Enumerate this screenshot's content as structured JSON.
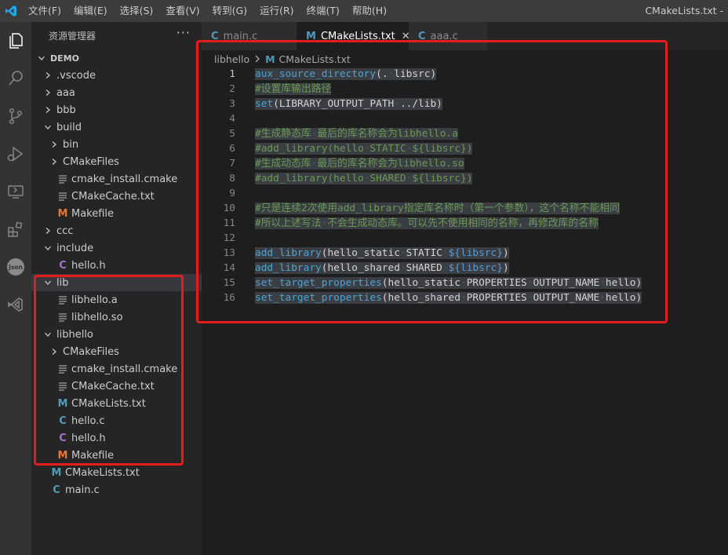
{
  "window": {
    "title": "CMakeLists.txt -",
    "menu": [
      "文件(F)",
      "编辑(E)",
      "选择(S)",
      "查看(V)",
      "转到(G)",
      "运行(R)",
      "终端(T)",
      "帮助(H)"
    ]
  },
  "sidebar": {
    "header": "资源管理器",
    "more": "···",
    "tree": [
      {
        "label": "DEMO",
        "kind": "root",
        "chev": "down",
        "indent": 0
      },
      {
        "label": ".vscode",
        "kind": "folder",
        "chev": "right",
        "indent": 1
      },
      {
        "label": "aaa",
        "kind": "folder",
        "chev": "right",
        "indent": 1
      },
      {
        "label": "bbb",
        "kind": "folder",
        "chev": "right",
        "indent": 1
      },
      {
        "label": "build",
        "kind": "folder",
        "chev": "down",
        "indent": 1
      },
      {
        "label": "bin",
        "kind": "folder",
        "chev": "right",
        "indent": 2
      },
      {
        "label": "CMakeFiles",
        "kind": "folder",
        "chev": "right",
        "indent": 2
      },
      {
        "label": "cmake_install.cmake",
        "kind": "txt",
        "indent": 2
      },
      {
        "label": "CMakeCache.txt",
        "kind": "txt",
        "indent": 2
      },
      {
        "label": "Makefile",
        "kind": "make",
        "indent": 2
      },
      {
        "label": "ccc",
        "kind": "folder",
        "chev": "right",
        "indent": 1
      },
      {
        "label": "include",
        "kind": "folder",
        "chev": "down",
        "indent": 1
      },
      {
        "label": "hello.h",
        "kind": "h",
        "indent": 2
      },
      {
        "label": "lib",
        "kind": "folder",
        "chev": "down",
        "indent": 1,
        "active": true
      },
      {
        "label": "libhello.a",
        "kind": "txt",
        "indent": 2
      },
      {
        "label": "libhello.so",
        "kind": "txt",
        "indent": 2
      },
      {
        "label": "libhello",
        "kind": "folder",
        "chev": "down",
        "indent": 1
      },
      {
        "label": "CMakeFiles",
        "kind": "folder",
        "chev": "right",
        "indent": 2
      },
      {
        "label": "cmake_install.cmake",
        "kind": "txt",
        "indent": 2
      },
      {
        "label": "CMakeCache.txt",
        "kind": "txt",
        "indent": 2
      },
      {
        "label": "CMakeLists.txt",
        "kind": "cmake",
        "indent": 2
      },
      {
        "label": "hello.c",
        "kind": "c",
        "indent": 2
      },
      {
        "label": "hello.h",
        "kind": "h",
        "indent": 2
      },
      {
        "label": "Makefile",
        "kind": "make",
        "indent": 2
      },
      {
        "label": "CMakeLists.txt",
        "kind": "cmake",
        "indent": 1
      },
      {
        "label": "main.c",
        "kind": "c",
        "indent": 1
      }
    ]
  },
  "tabs": [
    {
      "label": "main.c",
      "icon": "C",
      "kind": "c",
      "active": false
    },
    {
      "label": "CMakeLists.txt",
      "icon": "M",
      "kind": "cmake",
      "active": true,
      "close": "✕"
    },
    {
      "label": "aaa.c",
      "icon": "C",
      "kind": "c",
      "active": false
    }
  ],
  "breadcrumb": {
    "folder": "libhello",
    "file": "CMakeLists.txt",
    "icon": "M"
  },
  "editor": {
    "current_line": 1,
    "lines": [
      [
        [
          "fn",
          "aux_source_directory"
        ],
        [
          "tx",
          "("
        ],
        [
          "tx",
          "."
        ],
        [
          "ws",
          "·"
        ],
        [
          "tx",
          "libsrc)"
        ]
      ],
      [
        [
          "cm",
          "#设置库输出路径"
        ]
      ],
      [
        [
          "fn",
          "set"
        ],
        [
          "tx",
          "(LIBRARY_OUTPUT_PATH"
        ],
        [
          "ws",
          "·"
        ],
        [
          "tx",
          "../lib)"
        ]
      ],
      [],
      [
        [
          "cm",
          "#生成静态库"
        ],
        [
          "ws",
          "·"
        ],
        [
          "cm",
          "最后的库名称会为libhello.a"
        ]
      ],
      [
        [
          "cm",
          "#add_library(hello"
        ],
        [
          "ws",
          "·"
        ],
        [
          "cm",
          "STATIC"
        ],
        [
          "ws",
          "·"
        ],
        [
          "cm",
          "${libsrc})"
        ]
      ],
      [
        [
          "cm",
          "#生成动态库"
        ],
        [
          "ws",
          "·"
        ],
        [
          "cm",
          "最后的库名称会为libhello.so"
        ]
      ],
      [
        [
          "cm",
          "#add_library(hello"
        ],
        [
          "ws",
          "·"
        ],
        [
          "cm",
          "SHARED"
        ],
        [
          "ws",
          "·"
        ],
        [
          "cm",
          "${libsrc})"
        ]
      ],
      [],
      [
        [
          "cm",
          "#只是连续2次使用add_library指定库名称时（第一个参数），这个名称不能相同"
        ]
      ],
      [
        [
          "cm",
          "#所以上述写法"
        ],
        [
          "ws",
          "·"
        ],
        [
          "cm",
          "不会生成动态库。可以先不使用相同的名称，再修改库的名称"
        ]
      ],
      [],
      [
        [
          "fn",
          "add_library"
        ],
        [
          "tx",
          "(hello_static"
        ],
        [
          "ws",
          "·"
        ],
        [
          "tx",
          "STATIC"
        ],
        [
          "ws",
          "·"
        ],
        [
          "var",
          "${libsrc}"
        ],
        [
          "tx",
          ")"
        ]
      ],
      [
        [
          "fn",
          "add_library"
        ],
        [
          "tx",
          "(hello_shared"
        ],
        [
          "ws",
          "·"
        ],
        [
          "tx",
          "SHARED"
        ],
        [
          "ws",
          "·"
        ],
        [
          "var",
          "${libsrc}"
        ],
        [
          "tx",
          ")"
        ]
      ],
      [
        [
          "fn",
          "set_target_properties"
        ],
        [
          "tx",
          "(hello_static"
        ],
        [
          "ws",
          "·"
        ],
        [
          "tx",
          "PROPERTIES"
        ],
        [
          "ws",
          "·"
        ],
        [
          "tx",
          "OUTPUT_NAME"
        ],
        [
          "ws",
          "·"
        ],
        [
          "tx",
          "hello)"
        ]
      ],
      [
        [
          "fn",
          "set_target_properties"
        ],
        [
          "tx",
          "(hello_shared"
        ],
        [
          "ws",
          "·"
        ],
        [
          "tx",
          "PROPERTIES"
        ],
        [
          "ws",
          "·"
        ],
        [
          "tx",
          "OUTPUT_NAME"
        ],
        [
          "ws",
          "·"
        ],
        [
          "tx",
          "hello)"
        ]
      ]
    ]
  },
  "colors": {
    "accent": "#007acc",
    "annotation": "#e31c1c",
    "comment": "#6a9955",
    "function": "#4fa3d7"
  },
  "activity_icons": [
    "explorer-icon",
    "search-icon",
    "source-control-icon",
    "run-debug-icon",
    "remote-explorer-icon",
    "extensions-icon",
    "json-icon",
    "visual-studio-icon"
  ]
}
